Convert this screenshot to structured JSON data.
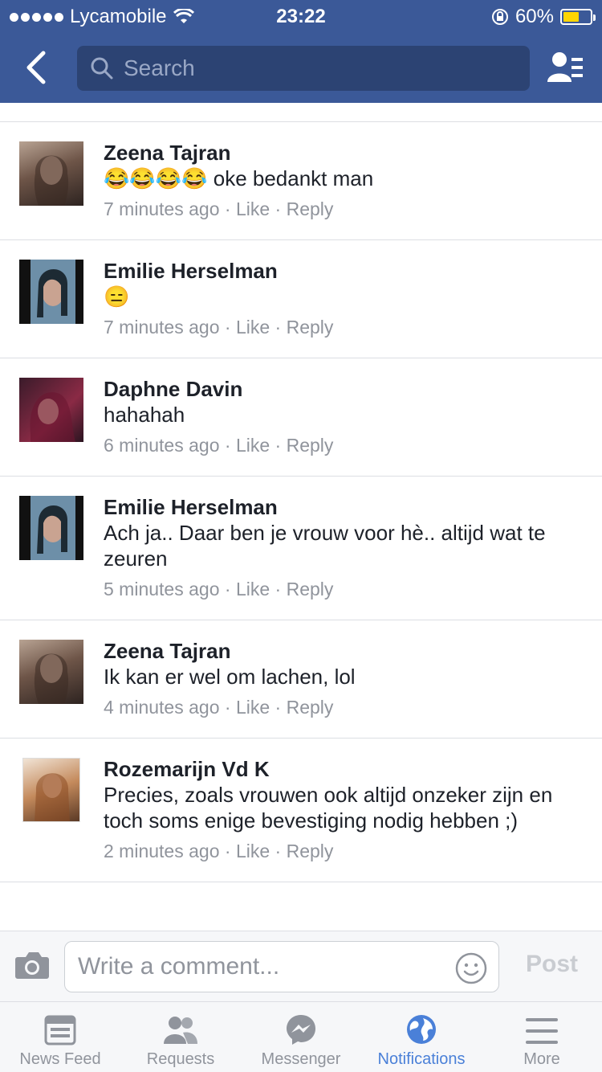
{
  "status_bar": {
    "carrier": "Lycamobile",
    "time": "23:22",
    "battery": "60%",
    "battery_level": 0.6
  },
  "search": {
    "placeholder": "Search"
  },
  "comments": [
    {
      "name": "Zeena Tajran",
      "text": "oke bedankt man",
      "emoji_prefix": "😂😂😂😂",
      "time": "7 minutes ago",
      "like": "Like",
      "reply": "Reply"
    },
    {
      "name": "Emilie Herselman",
      "text": "",
      "emoji_prefix": "😑",
      "time": "7 minutes ago",
      "like": "Like",
      "reply": "Reply"
    },
    {
      "name": "Daphne Davin",
      "text": "hahahah",
      "time": "6 minutes ago",
      "like": "Like",
      "reply": "Reply"
    },
    {
      "name": "Emilie Herselman",
      "text": "Ach ja.. Daar ben je vrouw voor hè.. altijd wat te zeuren",
      "time": "5 minutes ago",
      "like": "Like",
      "reply": "Reply"
    },
    {
      "name": "Zeena Tajran",
      "text": "Ik kan er wel om lachen, lol",
      "time": "4 minutes ago",
      "like": "Like",
      "reply": "Reply"
    },
    {
      "name": "Rozemarijn Vd K",
      "text": "Precies, zoals vrouwen ook altijd onzeker zijn en toch soms enige bevestiging nodig hebben ;)",
      "time": "2 minutes ago",
      "like": "Like",
      "reply": "Reply"
    }
  ],
  "composer": {
    "placeholder": "Write a comment...",
    "post_label": "Post"
  },
  "tabs": [
    {
      "label": "News Feed",
      "icon": "news-feed-icon"
    },
    {
      "label": "Requests",
      "icon": "requests-icon"
    },
    {
      "label": "Messenger",
      "icon": "messenger-icon"
    },
    {
      "label": "Notifications",
      "icon": "globe-icon",
      "active": true
    },
    {
      "label": "More",
      "icon": "menu-icon"
    }
  ],
  "colors": {
    "brand": "#3b5998",
    "active_tab": "#4a80d8",
    "meta_text": "#90949c"
  }
}
